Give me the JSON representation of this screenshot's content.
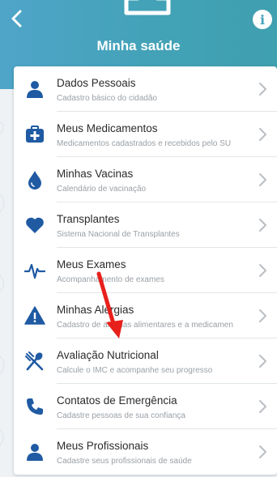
{
  "header": {
    "title": "Minha saúde",
    "info_label": "i"
  },
  "menu": {
    "items": [
      {
        "label": "Dados Pessoais",
        "subtitle": "Cadastro básico do cidadão",
        "icon": "person-icon"
      },
      {
        "label": "Meus Medicamentos",
        "subtitle": "Medicamentos cadastrados e recebidos pelo SU",
        "icon": "medical-kit-icon"
      },
      {
        "label": "Minhas Vacinas",
        "subtitle": "Calendário de vacinação",
        "icon": "drop-icon"
      },
      {
        "label": "Transplantes",
        "subtitle": "Sistema Nacional de Transplantes",
        "icon": "heart-icon"
      },
      {
        "label": "Meus Exames",
        "subtitle": "Acompanhamento de exames",
        "icon": "pulse-icon"
      },
      {
        "label": "Minhas Alergias",
        "subtitle": "Cadastro de alergias alimentares e a medicamen",
        "icon": "warning-icon"
      },
      {
        "label": "Avaliação Nutricional",
        "subtitle": "Calcule o IMC e acompanhe seu progresso",
        "icon": "cutlery-icon"
      },
      {
        "label": "Contatos de Emergência",
        "subtitle": "Cadastre pessoas de sua confiança",
        "icon": "phone-icon"
      },
      {
        "label": "Meus Profissionais",
        "subtitle": "Cadastre seus profissionais de saúde",
        "icon": "person-icon"
      }
    ]
  },
  "colors": {
    "header": "#46a3be",
    "icon": "#1f5aa3",
    "annotation_arrow": "#e8201c"
  }
}
